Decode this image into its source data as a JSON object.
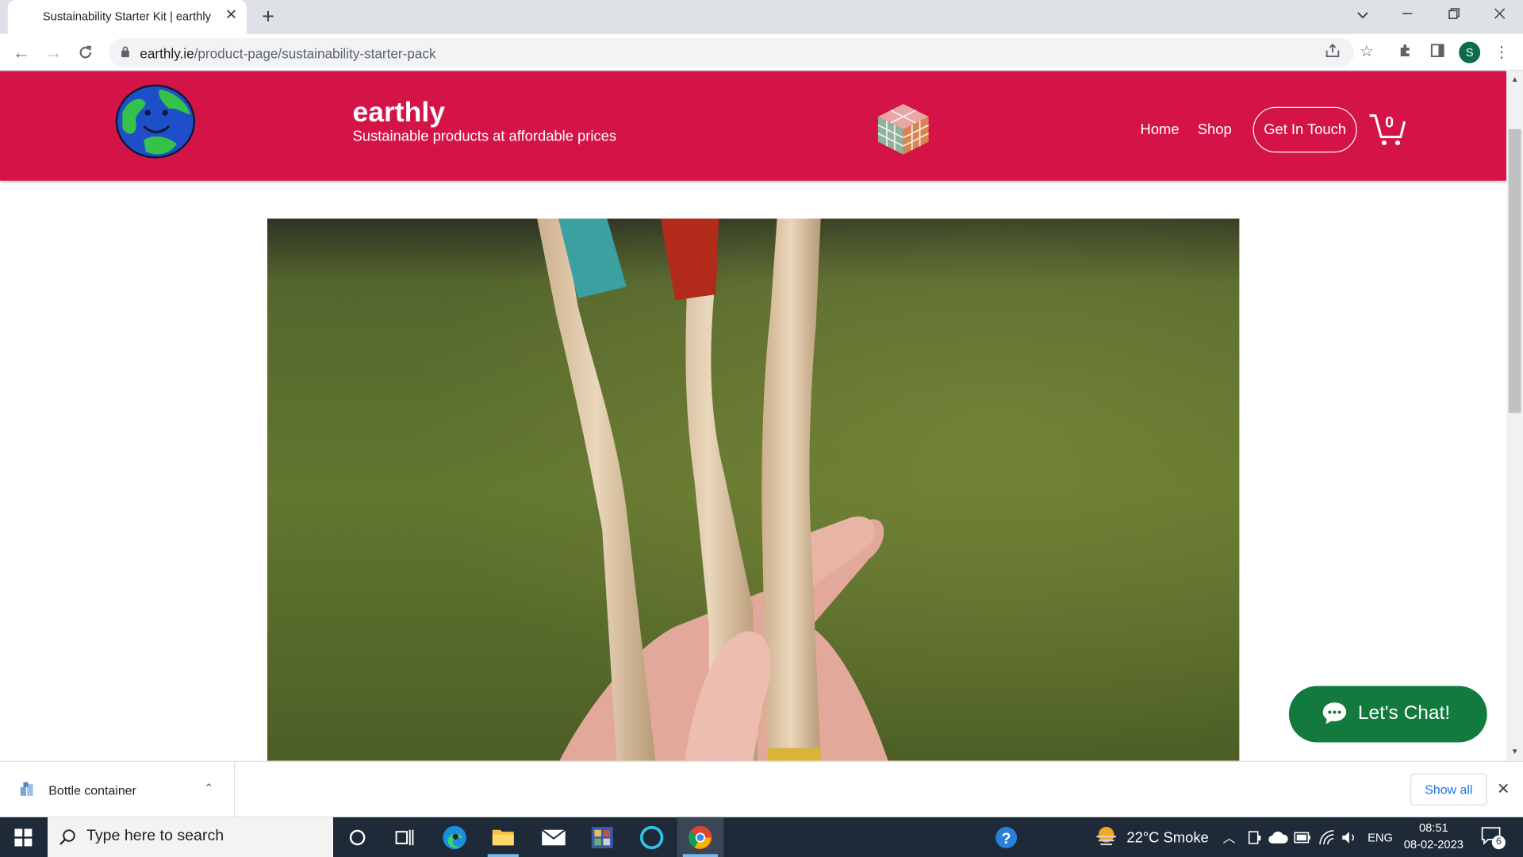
{
  "browser": {
    "tab_title": "Sustainability Starter Kit | earthly",
    "url_domain": "earthly.ie",
    "url_path": "/product-page/sustainability-starter-pack",
    "profile_initial": "S"
  },
  "site": {
    "brand": "earthly",
    "tagline": "Sustainable products at affordable prices",
    "nav": {
      "home": "Home",
      "shop": "Shop",
      "get_in_touch": "Get In Touch"
    },
    "cart_count": "0"
  },
  "chat": {
    "label": "Let's Chat!"
  },
  "download_bar": {
    "file_name": "Bottle container",
    "show_all": "Show all"
  },
  "taskbar": {
    "search_placeholder": "Type here to search",
    "weather": "22°C  Smoke",
    "language": "ENG",
    "time": "08:51",
    "date": "08-02-2023",
    "notification_count": "6"
  },
  "colors": {
    "header_red": "#d41447",
    "chat_green": "#137a3e"
  }
}
